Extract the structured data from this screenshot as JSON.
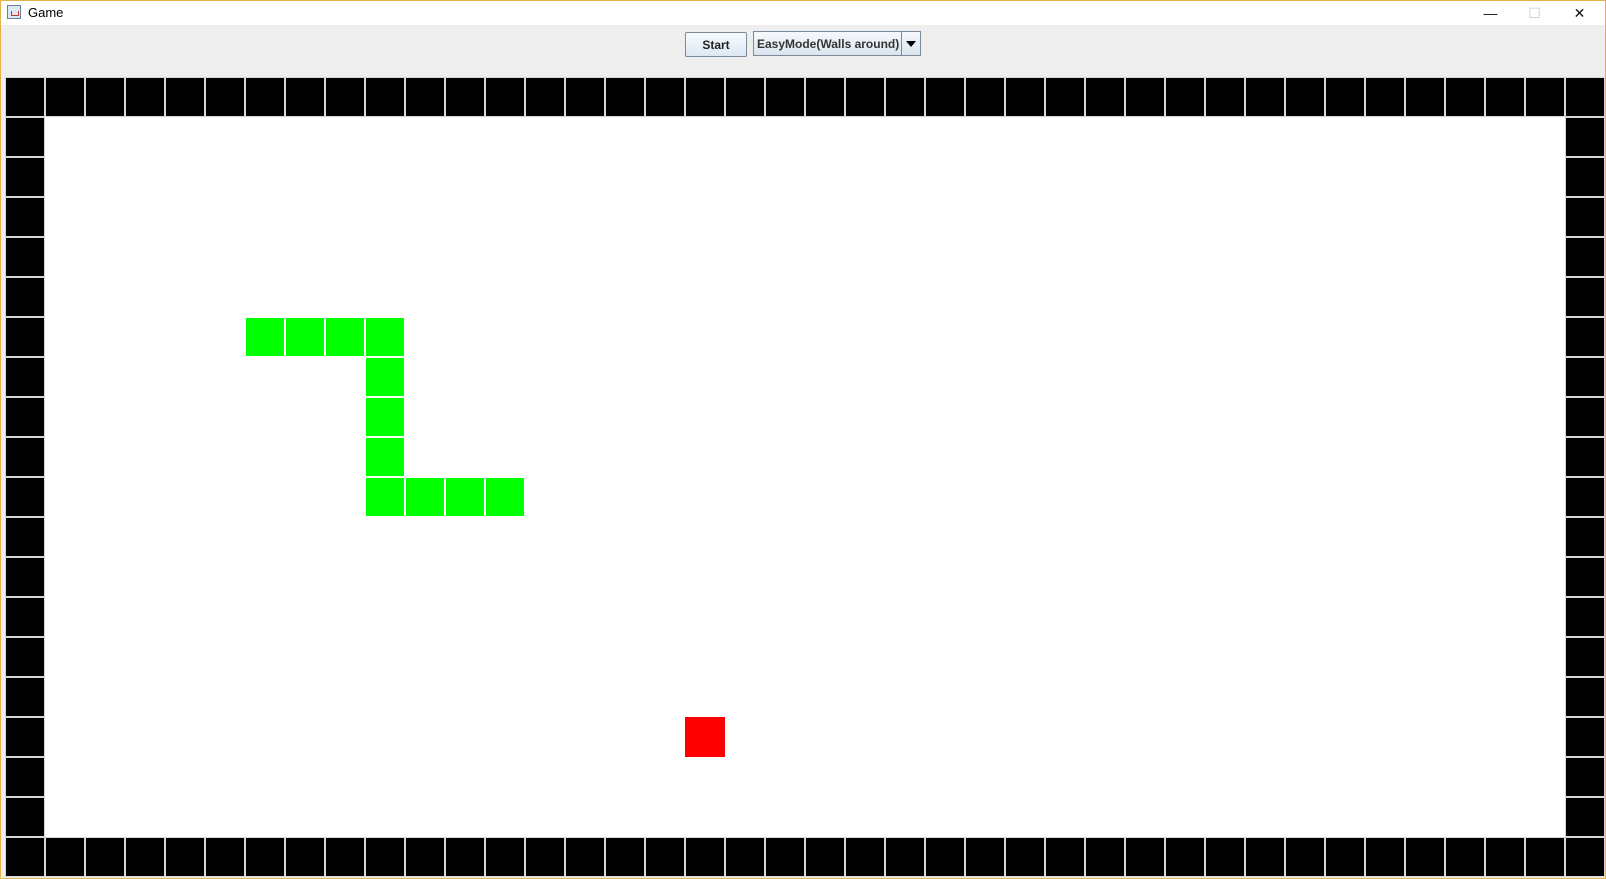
{
  "window": {
    "title": "Game",
    "controls": {
      "minimize": "—",
      "maximize": "☐",
      "close": "✕"
    }
  },
  "toolbar": {
    "start_label": "Start",
    "mode_selected": "EasyMode(Walls around)"
  },
  "board": {
    "cols": 40,
    "rows": 20,
    "snake": [
      [
        6,
        6
      ],
      [
        7,
        6
      ],
      [
        8,
        6
      ],
      [
        9,
        6
      ],
      [
        9,
        7
      ],
      [
        9,
        8
      ],
      [
        9,
        9
      ],
      [
        9,
        10
      ],
      [
        10,
        10
      ],
      [
        11,
        10
      ],
      [
        12,
        10
      ]
    ],
    "food": [
      17,
      16
    ],
    "colors": {
      "wall": "#000000",
      "snake": "#00ff00",
      "food": "#ff0000",
      "floor": "#ffffff"
    }
  }
}
